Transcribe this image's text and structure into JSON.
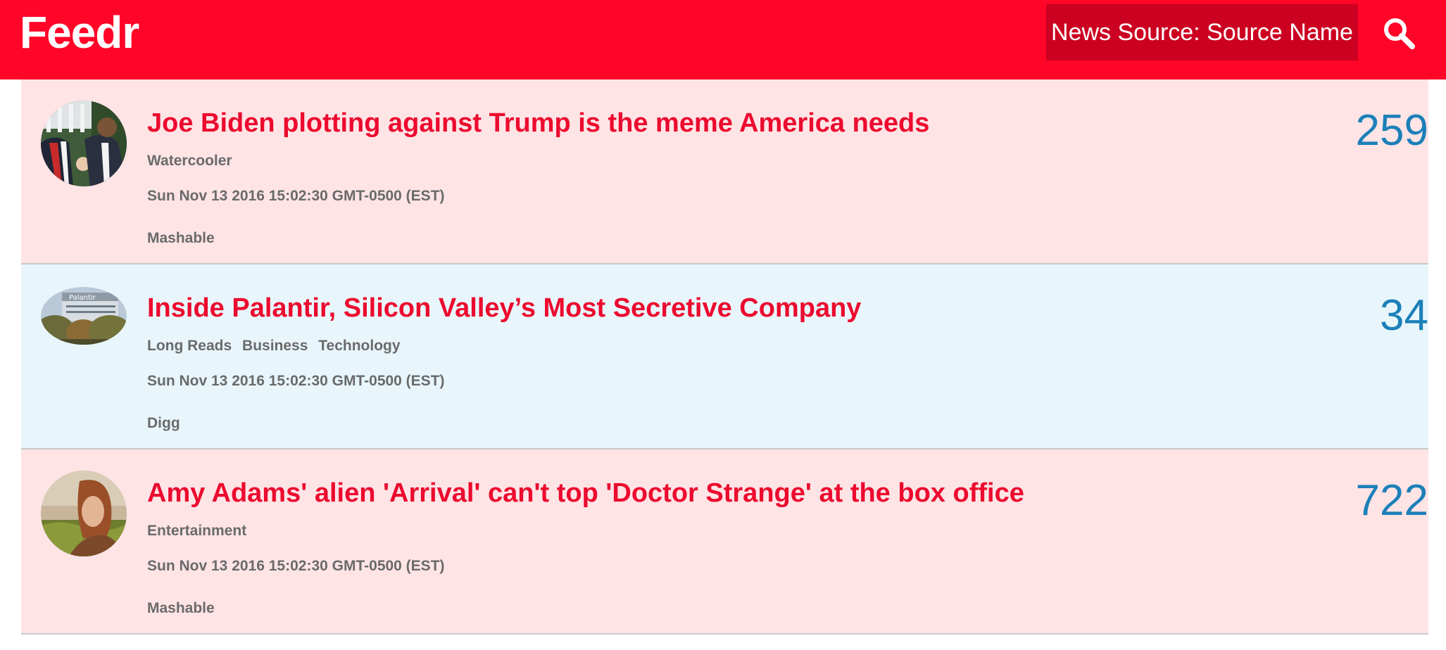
{
  "app": {
    "logo": "Feedr",
    "source_selector": "News Source: Source Name"
  },
  "colors": {
    "header": "#ff0528",
    "selector": "#cc0021",
    "title": "#ec0a2e",
    "count": "#1c80b8",
    "row_pink": "#ffe4e6",
    "row_blue": "#e8f6fc"
  },
  "articles": [
    {
      "title": "Joe Biden plotting against Trump is the meme America needs",
      "tags": [
        "Watercooler"
      ],
      "date": "Sun Nov 13 2016 15:02:30 GMT-0500 (EST)",
      "source": "Mashable",
      "count": "259",
      "thumbnail": "biden-obama-photo"
    },
    {
      "title": "Inside Palantir, Silicon Valley’s Most Secretive Company",
      "tags": [
        "Long Reads",
        "Business",
        "Technology"
      ],
      "date": "Sun Nov 13 2016 15:02:30 GMT-0500 (EST)",
      "source": "Digg",
      "count": "34",
      "thumbnail": "palantir-building-photo"
    },
    {
      "title": "Amy Adams' alien 'Arrival' can't top 'Doctor Strange' at the box office",
      "tags": [
        "Entertainment"
      ],
      "date": "Sun Nov 13 2016 15:02:30 GMT-0500 (EST)",
      "source": "Mashable",
      "count": "722",
      "thumbnail": "amy-adams-photo"
    }
  ]
}
